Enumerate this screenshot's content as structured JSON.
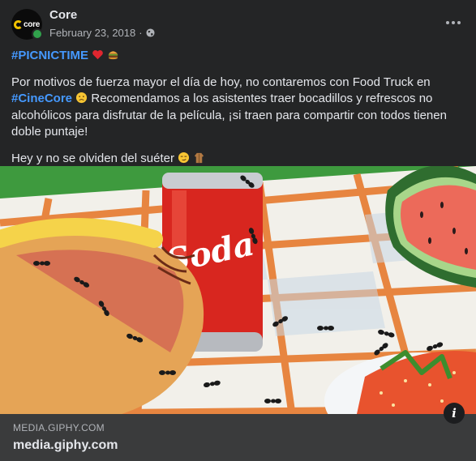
{
  "post": {
    "page_name": "Core",
    "avatar_text": "core",
    "date": "February 23, 2018",
    "separator": "·",
    "privacy_icon": "globe-icon",
    "more_icon": "more-horizontal-icon",
    "hashtag_line": {
      "tag": "#PICNICTIME",
      "emojis": [
        "heart-emoji",
        "burger-emoji"
      ]
    },
    "paragraph": {
      "part1": "Por motivos de fuerza mayor el día de hoy, no contaremos con Food Truck en ",
      "tag": "#CineCore",
      "emoji": "sad-face-emoji",
      "part2": " Recomendamos a los asistentes traer bocadillos y refrescos no alcohólicos para disfrutar de la película, ¡si traen para compartir con todos tienen doble puntaje!"
    },
    "line3": {
      "text": "Hey y no se olviden del suéter ",
      "emojis": [
        "smirk-emoji",
        "coat-emoji"
      ]
    }
  },
  "media": {
    "soda_label": "Soda",
    "info_label": "i"
  },
  "link_preview": {
    "domain": "MEDIA.GIPHY.COM",
    "title": "media.giphy.com"
  },
  "colors": {
    "background": "#242526",
    "hashtag": "#4599ff",
    "footer": "#3a3b3c",
    "online": "#31a24c"
  }
}
